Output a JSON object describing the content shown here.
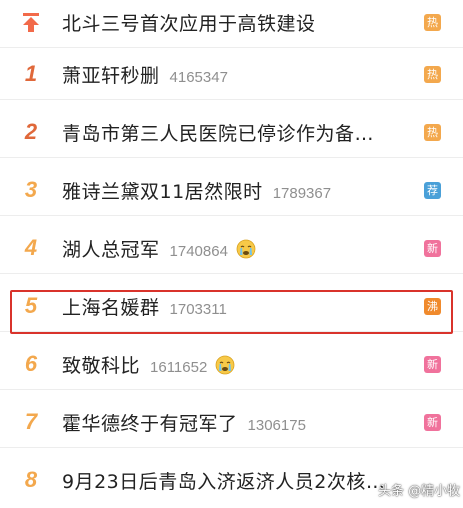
{
  "colors": {
    "rank_top": "#f26a4a",
    "rank_hot": "#e0683a",
    "rank_mid": "#f3a84d",
    "badge_hot": "#f3a84d",
    "badge_rec": "#4aa0d8",
    "badge_new": "#f0729c",
    "badge_boil": "#f08a2c",
    "highlight_border": "#d9332b"
  },
  "items": [
    {
      "rank": "",
      "title": "北斗三号首次应用于高铁建设",
      "count": "",
      "badge": "热",
      "badge_type": "hot",
      "rank_icon": "top-arrow-icon"
    },
    {
      "rank": "1",
      "title": "萧亚轩秒删",
      "count": "4165347",
      "badge": "热",
      "badge_type": "hot"
    },
    {
      "rank": "2",
      "title": "青岛市第三人民医院已停诊作为备…",
      "count": "",
      "badge": "热",
      "badge_type": "hot"
    },
    {
      "rank": "3",
      "title": "雅诗兰黛双11居然限时",
      "count": "1789367",
      "badge": "荐",
      "badge_type": "rec"
    },
    {
      "rank": "4",
      "title": "湖人总冠军",
      "count": "1740864",
      "badge": "新",
      "badge_type": "new",
      "emoji": "crying-face-icon"
    },
    {
      "rank": "5",
      "title": "上海名媛群",
      "count": "1703311",
      "badge": "沸",
      "badge_type": "boil"
    },
    {
      "rank": "6",
      "title": "致敬科比",
      "count": "1611652",
      "badge": "新",
      "badge_type": "new",
      "emoji": "crying-face-icon"
    },
    {
      "rank": "7",
      "title": "霍华德终于有冠军了",
      "count": "1306175",
      "badge": "新",
      "badge_type": "new"
    },
    {
      "rank": "8",
      "title": "9月23日后青岛入济返济人员2次核…",
      "count": "",
      "badge": "",
      "badge_type": ""
    }
  ],
  "watermark": {
    "text": "头条 @精小牧"
  }
}
